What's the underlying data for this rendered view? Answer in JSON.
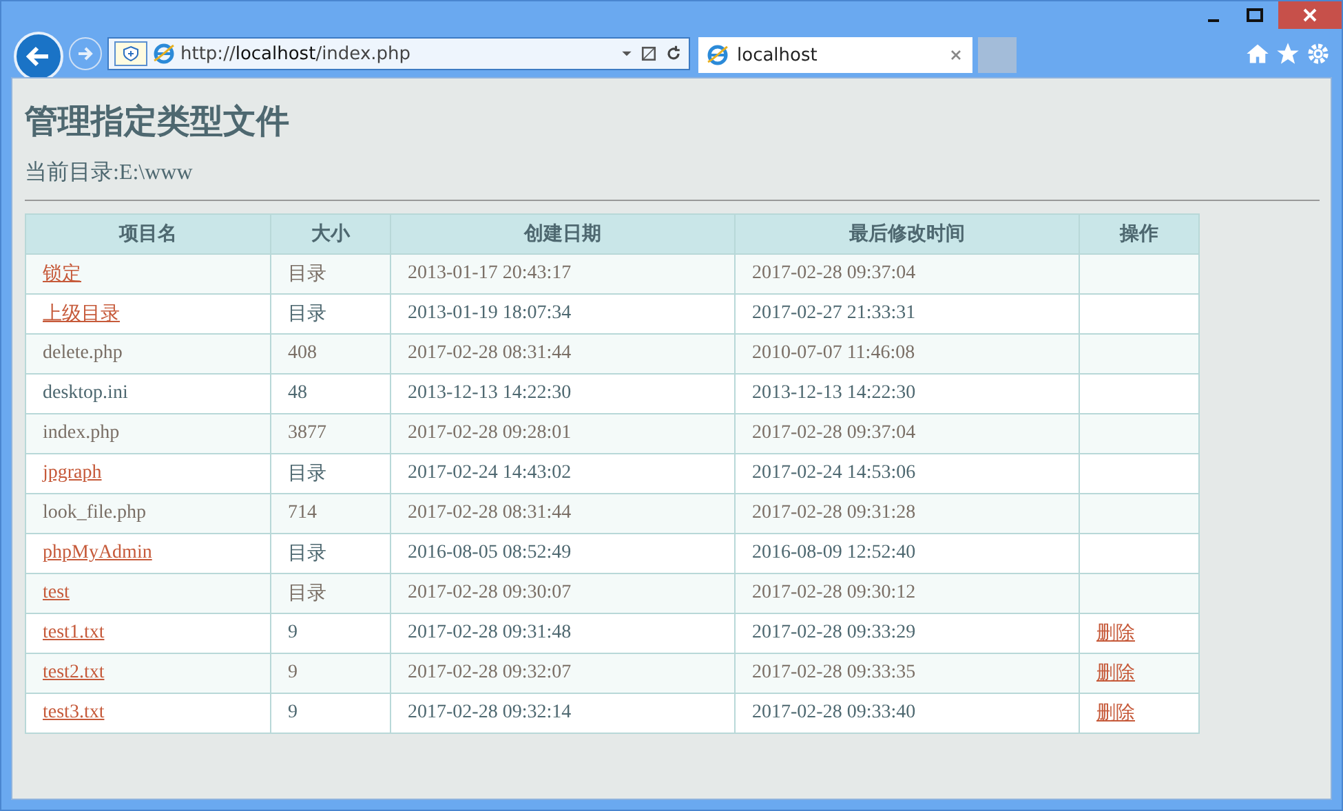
{
  "browser": {
    "address": "http://**localhost**/index.php",
    "tab_title": "localhost"
  },
  "page": {
    "title": "管理指定类型文件",
    "current_dir": "当前目录:E:\\www"
  },
  "table": {
    "columns": [
      "项目名",
      "大小",
      "创建日期",
      "最后修改时间",
      "操作"
    ],
    "rows": [
      {
        "name": "锁定",
        "link": true,
        "size": "目录",
        "created": "2013-01-17 20:43:17",
        "modified": "2017-02-28 09:37:04"
      },
      {
        "name": "上级目录",
        "link": true,
        "size": "目录",
        "created": "2013-01-19 18:07:34",
        "modified": "2017-02-27 21:33:31"
      },
      {
        "name": "delete.php",
        "link": false,
        "size": "408",
        "created": "2017-02-28 08:31:44",
        "modified": "2010-07-07 11:46:08"
      },
      {
        "name": "desktop.ini",
        "link": false,
        "size": "48",
        "created": "2013-12-13 14:22:30",
        "modified": "2013-12-13 14:22:30"
      },
      {
        "name": "index.php",
        "link": false,
        "size": "3877",
        "created": "2017-02-28 09:28:01",
        "modified": "2017-02-28 09:37:04"
      },
      {
        "name": "jpgraph",
        "link": true,
        "size": "目录",
        "created": "2017-02-24 14:43:02",
        "modified": "2017-02-24 14:53:06"
      },
      {
        "name": "look_file.php",
        "link": false,
        "size": "714",
        "created": "2017-02-28 08:31:44",
        "modified": "2017-02-28 09:31:28"
      },
      {
        "name": "phpMyAdmin",
        "link": true,
        "size": "目录",
        "created": "2016-08-05 08:52:49",
        "modified": "2016-08-09 12:52:40"
      },
      {
        "name": "test",
        "link": true,
        "size": "目录",
        "created": "2017-02-28 09:30:07",
        "modified": "2017-02-28 09:30:12"
      },
      {
        "name": "test1.txt",
        "link": true,
        "size": "9",
        "created": "2017-02-28 09:31:48",
        "modified": "2017-02-28 09:33:29",
        "action": "删除"
      },
      {
        "name": "test2.txt",
        "link": true,
        "size": "9",
        "created": "2017-02-28 09:32:07",
        "modified": "2017-02-28 09:33:35",
        "action": "删除"
      },
      {
        "name": "test3.txt",
        "link": true,
        "size": "9",
        "created": "2017-02-28 09:32:14",
        "modified": "2017-02-28 09:33:40",
        "action": "删除"
      }
    ]
  }
}
